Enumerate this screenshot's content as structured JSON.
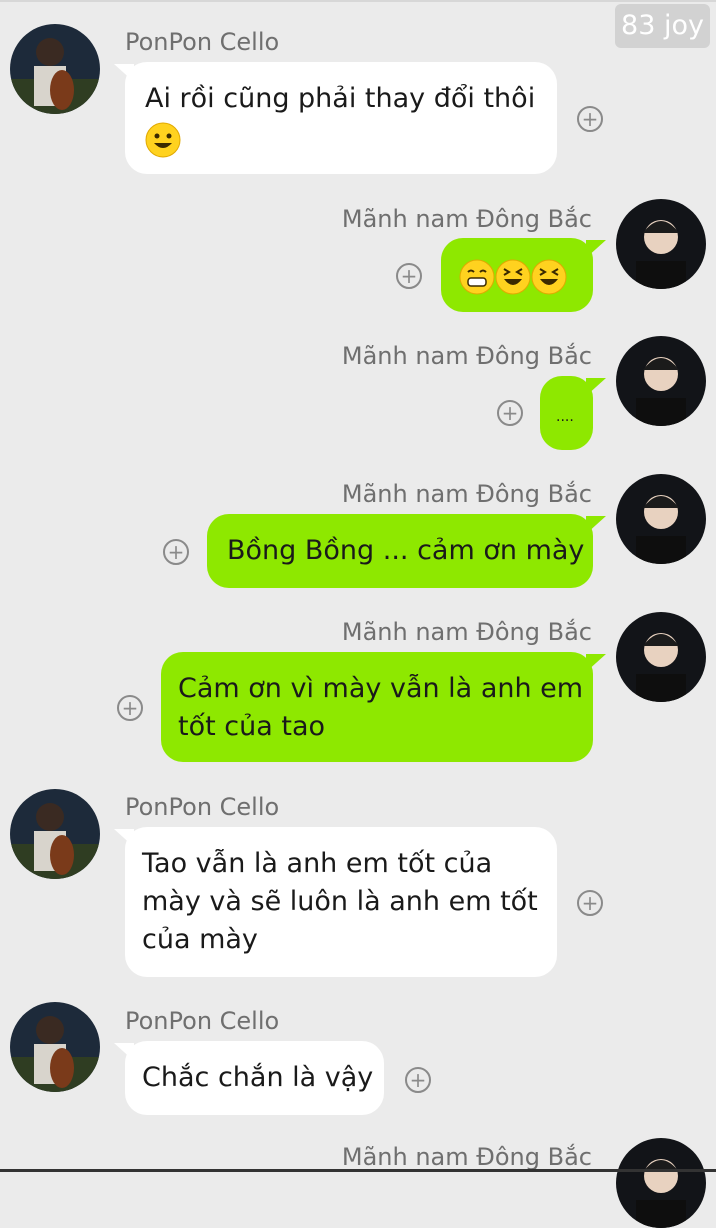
{
  "watermark": "83 joy",
  "colors": {
    "background": "#ebebeb",
    "incoming_bubble": "#ffffff",
    "outgoing_bubble": "#8ee800",
    "name_text": "#6f6f6f"
  },
  "contacts": {
    "other": "PonPon Cello",
    "me": "Mãnh nam Đông Bắc"
  },
  "messages": [
    {
      "sender": "PonPon Cello",
      "side": "left",
      "lines": [
        "Ai rồi cũng phải thay đổi thôi"
      ],
      "emoji": [
        "smiley-emoji"
      ]
    },
    {
      "sender": "Mãnh nam Đông Bắc",
      "side": "right",
      "lines": [],
      "emoji": [
        "grin-emoji",
        "laughing-emoji",
        "laughing-emoji"
      ]
    },
    {
      "sender": "Mãnh nam Đông Bắc",
      "side": "right",
      "lines": [
        "...."
      ]
    },
    {
      "sender": "Mãnh nam Đông Bắc",
      "side": "right",
      "lines": [
        "Bồng Bồng ... cảm ơn mày"
      ]
    },
    {
      "sender": "Mãnh nam Đông Bắc",
      "side": "right",
      "lines": [
        "Cảm ơn vì mày vẫn là anh em",
        "tốt của tao"
      ]
    },
    {
      "sender": "PonPon Cello",
      "side": "left",
      "lines": [
        "Tao vẫn là anh em tốt của",
        "mày và sẽ luôn là anh em tốt",
        "của mày"
      ]
    },
    {
      "sender": "PonPon Cello",
      "side": "left",
      "lines": [
        "Chắc chắn là vậy"
      ]
    },
    {
      "sender": "Mãnh nam Đông Bắc",
      "side": "right",
      "lines": []
    }
  ],
  "icons": {
    "react": "plus-circle-icon"
  }
}
